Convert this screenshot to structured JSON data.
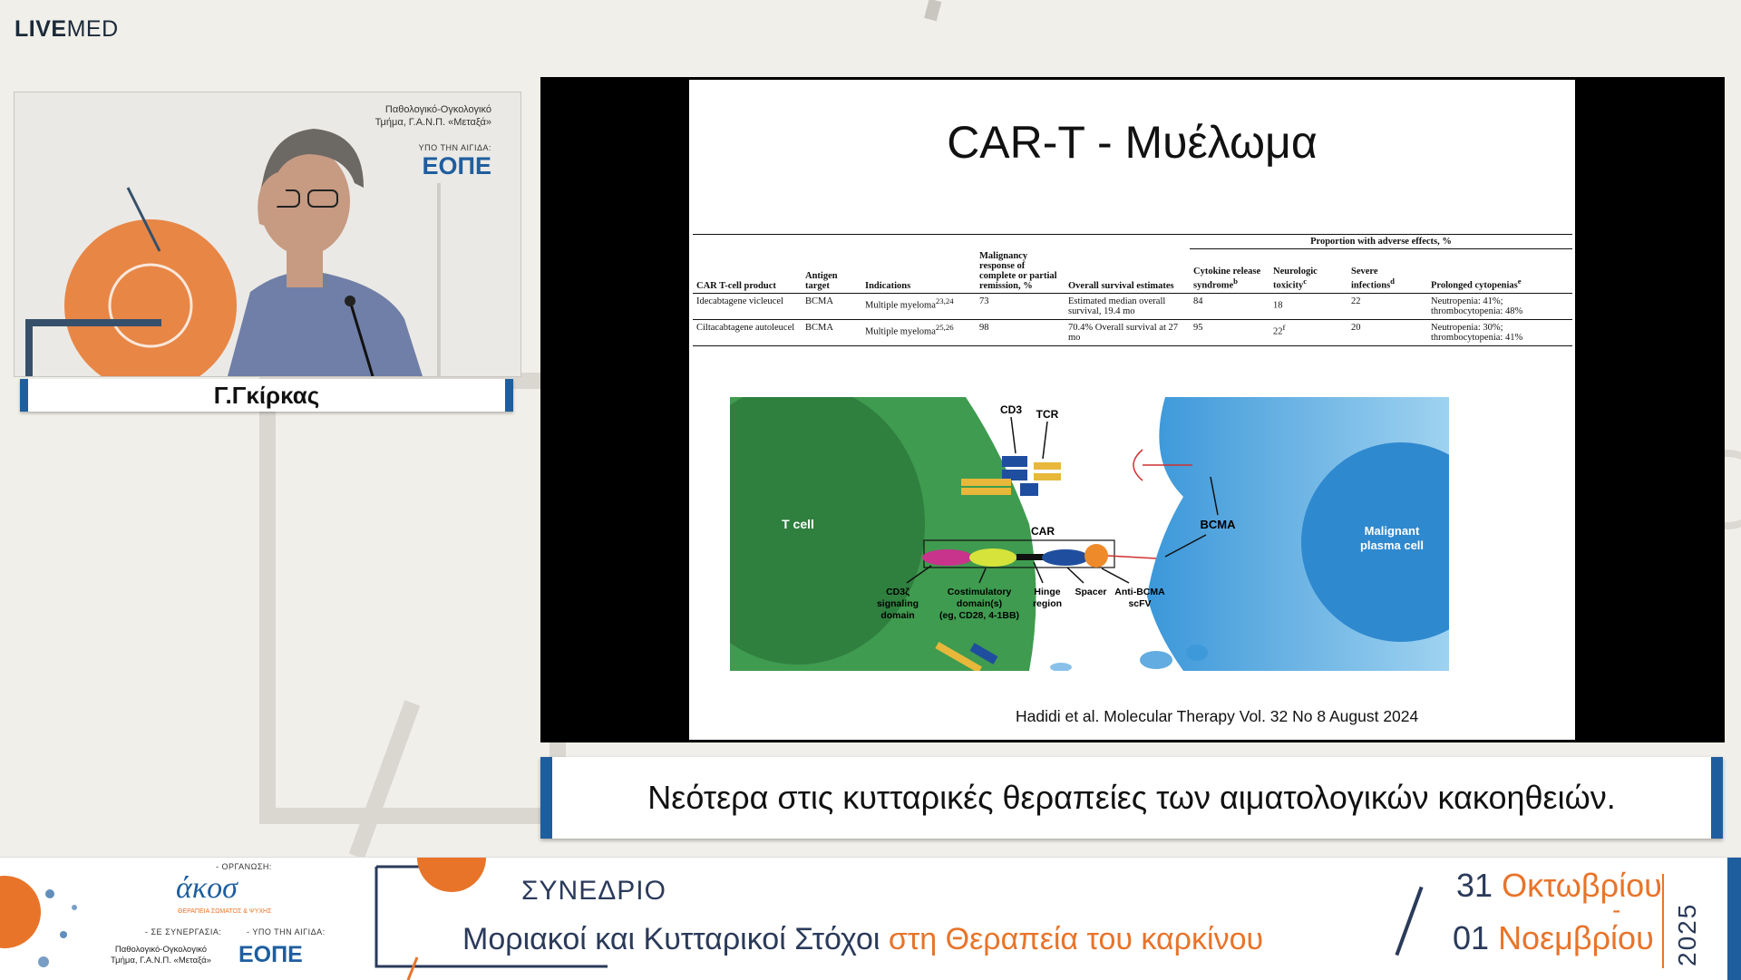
{
  "brand": {
    "live": "LIVE",
    "med": "MED"
  },
  "speaker": {
    "name": "Γ.Γκίρκας",
    "backdrop_lines": [
      "Παθολογικό-Ογκολογικό",
      "Τμήμα, Γ.Α.Ν.Π. «Μεταξά»"
    ],
    "backdrop_patronage": "ΥΠΟ ΤΗΝ ΑΙΓΙΔΑ:",
    "backdrop_logo": "ΕΟΠΕ"
  },
  "slide": {
    "title": "CAR-T - Μυέλωμα",
    "table": {
      "group_header": "Proportion with adverse effects, %",
      "columns": [
        "CAR T-cell product",
        "Antigen target",
        "Indications",
        "Malignancy response of complete or partial remission, %",
        "Overall survival estimates",
        "Cytokine release syndrome",
        "Neurologic toxicity",
        "Severe infections",
        "Prolonged cytopenias"
      ],
      "column_sups": [
        "",
        "",
        "",
        "",
        "",
        "b",
        "c",
        "d",
        "e"
      ],
      "rows": [
        {
          "product": "Idecabtagene vicleucel",
          "target": "BCMA",
          "indication": "Multiple myeloma",
          "ind_sup": "23,24",
          "response": "73",
          "survival": "Estimated median overall survival, 19.4 mo",
          "crs": "84",
          "neuro": "18",
          "neuro_sup": "",
          "infections": "22",
          "cytopenias": "Neutropenia: 41%; thrombocytopenia: 48%"
        },
        {
          "product": "Ciltacabtagene autoleucel",
          "target": "BCMA",
          "indication": "Multiple myeloma",
          "ind_sup": "25,26",
          "response": "98",
          "survival": "70.4% Overall survival at 27 mo",
          "crs": "95",
          "neuro": "22",
          "neuro_sup": "f",
          "infections": "20",
          "cytopenias": "Neutropenia: 30%; thrombocytopenia: 41%"
        }
      ]
    },
    "diagram": {
      "t_cell": "T cell",
      "cd3": "CD3",
      "tcr": "TCR",
      "car": "CAR",
      "bcma": "BCMA",
      "plasma": [
        "Malignant",
        "plasma cell"
      ],
      "labels": [
        {
          "lines": [
            "CD3ζ",
            "signaling",
            "domain"
          ]
        },
        {
          "lines": [
            "Costimulatory",
            "domain(s)",
            "(eg, CD28, 4-1BB)"
          ]
        },
        {
          "lines": [
            "Hinge",
            "region"
          ]
        },
        {
          "lines": [
            "Spacer"
          ]
        },
        {
          "lines": [
            "Anti-BCMA",
            "scFV"
          ]
        }
      ]
    },
    "citation": "Hadidi et al. Molecular Therapy Vol. 32 No 8 August 2024"
  },
  "subtitle": "Νεότερα στις κυτταρικές θεραπείες των αιματολογικών κακοηθειών.",
  "footer": {
    "organizer_label": "- ΟΡΓΑΝΩΣΗ:",
    "organizer_logo": "άκοσ",
    "organizer_tagline": "ΘΕΡΑΠΕΙΑ ΣΩΜΑΤΟΣ & ΨΥΧΗΣ",
    "collab_label": "- ΣΕ ΣΥΝΕΡΓΑΣΙΑ:",
    "collab_lines": [
      "Παθολογικό-Ογκολογικό",
      "Τμήμα, Γ.Α.Ν.Π. «Μεταξά»"
    ],
    "patron_label": "- ΥΠΟ ΤΗΝ ΑΙΓΙΔΑ:",
    "patron_logo": "ΕΟΠΕ",
    "conference_label": "ΣΥΝΕΔΡΙΟ",
    "conference_title_a": "Μοριακοί και Κυτταρικοί Στόχοι",
    "conference_title_b": "στη Θεραπεία του καρκίνου",
    "date_day1": "31",
    "date_month1": "Οκτωβρίου",
    "date_sep": "-",
    "date_day2": "01",
    "date_month2": "Νοεμβρίου",
    "year": "2025"
  },
  "colors": {
    "accent_blue": "#1f5e9e",
    "accent_orange": "#e8742a",
    "tcell_green": "#3f9b4f",
    "plasma_blue": "#4aa3df"
  }
}
